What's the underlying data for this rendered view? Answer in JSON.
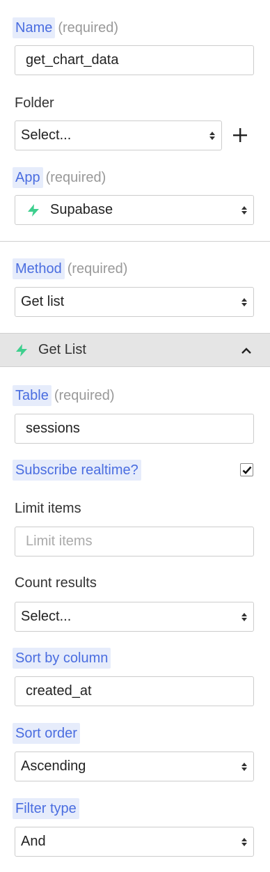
{
  "name_field": {
    "label": "Name",
    "required": "(required)",
    "value": "get_chart_data"
  },
  "folder_field": {
    "label": "Folder",
    "value": "Select..."
  },
  "app_field": {
    "label": "App",
    "required": "(required)",
    "value": "Supabase",
    "icon": "supabase-bolt-icon",
    "icon_color": "#3ecf8e"
  },
  "method_field": {
    "label": "Method",
    "required": "(required)",
    "value": "Get list"
  },
  "section": {
    "title": "Get List",
    "icon": "supabase-bolt-icon",
    "expanded": true
  },
  "table_field": {
    "label": "Table",
    "required": "(required)",
    "value": "sessions"
  },
  "subscribe_field": {
    "label": "Subscribe realtime?",
    "checked": true
  },
  "limit_field": {
    "label": "Limit items",
    "placeholder": "Limit items",
    "value": ""
  },
  "count_field": {
    "label": "Count results",
    "value": "Select..."
  },
  "sort_column_field": {
    "label": "Sort by column",
    "value": "created_at"
  },
  "sort_order_field": {
    "label": "Sort order",
    "value": "Ascending"
  },
  "filter_type_field": {
    "label": "Filter type",
    "value": "And"
  },
  "colors": {
    "accent": "#4a6de0",
    "accent_bg": "#e6ecfb",
    "supabase": "#3ecf8e",
    "section_bg": "#e5e5e5"
  }
}
